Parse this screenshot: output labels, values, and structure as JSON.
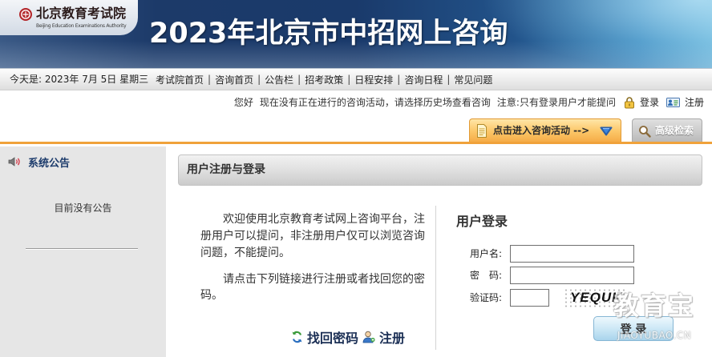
{
  "banner": {
    "logo_cn": "北京教育考试院",
    "logo_en": "Beijing Education Examinations Authority",
    "title": "2023年北京市中招网上咨询"
  },
  "nav": {
    "today": "今天是: 2023年 7月 5日 星期三",
    "separator": "|",
    "links": [
      "考试院首页",
      "咨询首页",
      "公告栏",
      "招考政策",
      "日程安排",
      "咨询日程",
      "常见问题"
    ]
  },
  "notice": {
    "greeting": "您好",
    "message": "现在没有正在进行的咨询活动，请选择历史场查看咨询",
    "note": "注意:只有登录用户才能提问",
    "login": "登录",
    "register": "注册"
  },
  "tabs": {
    "activity": "点击进入咨询活动 -->",
    "search": "高级检索"
  },
  "sidebar": {
    "title": "系统公告",
    "empty": "目前没有公告"
  },
  "panel": {
    "title": "用户注册与登录",
    "intro": "欢迎使用北京教育考试网上咨询平台，注册用户可以提问，非注册用户仅可以浏览咨询问题，不能提问。",
    "hint": "请点击下列链接进行注册或者找回您的密码。",
    "recover_link": "找回密码",
    "register_link": "注册"
  },
  "login": {
    "title": "用户登录",
    "username_label": "用户名:",
    "username_value": "",
    "password_label": "密　码:",
    "password_value": "",
    "captcha_label": "验证码:",
    "captcha_value": "",
    "captcha_code": "YEQUK",
    "submit": "登 录"
  },
  "watermark": {
    "cn": "教育宝",
    "en": "JIAOYUBAO.CN"
  },
  "colors": {
    "banner": "#1c3a69",
    "accent_orange": "#f0a23a",
    "sidebar": "#e6e6e6",
    "link": "#1b2f55"
  },
  "icons": {
    "logo": "emblem-icon",
    "login": "lock-icon",
    "register": "register-card-icon",
    "activity_tab": "document-icon",
    "dropdown": "dropdown-triangle-icon",
    "search_tab": "magnifier-icon",
    "announcement": "speaker-icon",
    "recover": "refresh-icon",
    "register_link": "user-add-icon"
  }
}
